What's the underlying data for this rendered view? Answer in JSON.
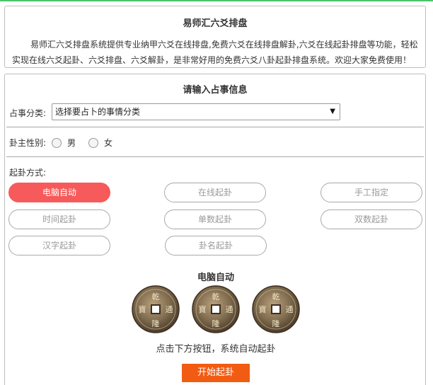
{
  "intro": {
    "title": "易师汇六爻排盘",
    "text": "易师汇六爻排盘系统提供专业纳甲六爻在线排盘,免费六爻在线排盘解卦,六爻在线起卦排盘等功能，轻松实现在线六爻起卦、六爻排盘、六爻解卦，是非常好用的免费六爻八卦起卦排盘系统。欢迎大家免费使用！"
  },
  "form": {
    "title": "请输入占事信息",
    "category_label": "占事分类:",
    "category_value": "选择要占卜的事情分类",
    "gender_label": "卦主性别:",
    "gender_male": "男",
    "gender_female": "女",
    "method_label": "起卦方式:",
    "methods": [
      "电脑自动",
      "在线起卦",
      "手工指定",
      "时间起卦",
      "单数起卦",
      "双数起卦",
      "汉字起卦",
      "卦名起卦"
    ],
    "active_method": "电脑自动",
    "mode_title": "电脑自动",
    "hint": "点击下方按钮，系统自动起卦",
    "start_label": "开始起卦"
  },
  "coin_chars": [
    "乾",
    "隆",
    "通",
    "寶"
  ],
  "colors": {
    "active": "#f75a5a",
    "start": "#f25b12",
    "topbar": "#4cc36a"
  }
}
